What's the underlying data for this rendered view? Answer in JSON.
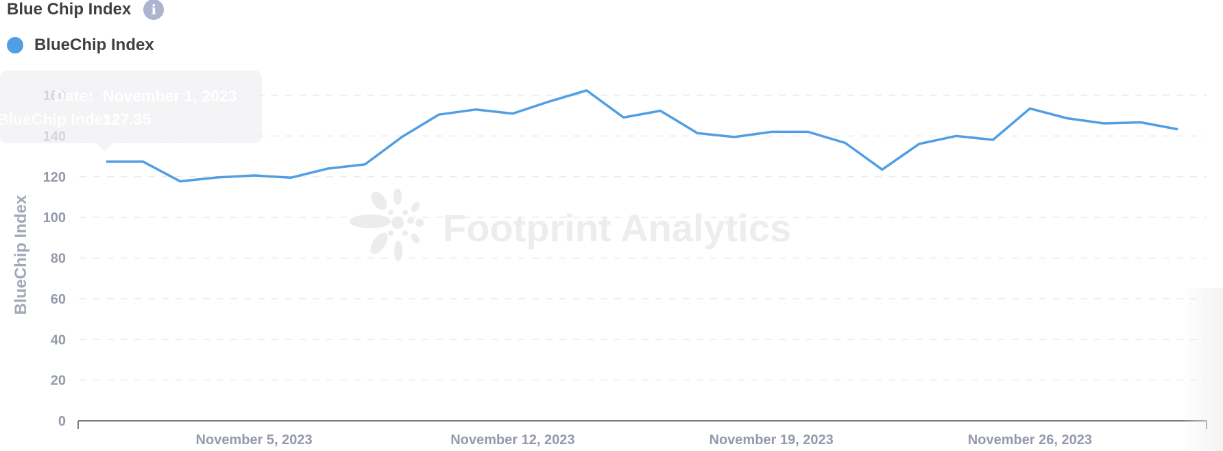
{
  "header": {
    "title": "Blue Chip Index",
    "info_icon": "info-icon"
  },
  "legend": {
    "items": [
      {
        "label": "BlueChip Index",
        "color": "#509ee3"
      }
    ]
  },
  "watermark": "Footprint Analytics",
  "tooltip": {
    "date_key": "Date:",
    "date_value": "November 1, 2023",
    "value_key": "BlueChip Index:",
    "value_value": "127.35"
  },
  "chart_data": {
    "type": "line",
    "title": "Blue Chip Index",
    "xlabel": "",
    "ylabel": "BlueChip Index",
    "ylim": [
      0,
      160
    ],
    "yticks": [
      0,
      20,
      40,
      60,
      80,
      100,
      120,
      140,
      160
    ],
    "grid": true,
    "legend": "top-left",
    "x": [
      "2023-11-01",
      "2023-11-02",
      "2023-11-03",
      "2023-11-04",
      "2023-11-05",
      "2023-11-06",
      "2023-11-07",
      "2023-11-08",
      "2023-11-09",
      "2023-11-10",
      "2023-11-11",
      "2023-11-12",
      "2023-11-13",
      "2023-11-14",
      "2023-11-15",
      "2023-11-16",
      "2023-11-17",
      "2023-11-18",
      "2023-11-19",
      "2023-11-20",
      "2023-11-21",
      "2023-11-22",
      "2023-11-23",
      "2023-11-24",
      "2023-11-25",
      "2023-11-26",
      "2023-11-27",
      "2023-11-28",
      "2023-11-29",
      "2023-11-30"
    ],
    "xtick_labels": [
      {
        "index": 4,
        "label": "November 5, 2023"
      },
      {
        "index": 11,
        "label": "November 12, 2023"
      },
      {
        "index": 18,
        "label": "November 19, 2023"
      },
      {
        "index": 25,
        "label": "November 26, 2023"
      }
    ],
    "series": [
      {
        "name": "BlueChip Index",
        "color": "#509ee3",
        "values": [
          127.35,
          127.35,
          117.7,
          119.6,
          120.6,
          119.5,
          124.0,
          126.0,
          139.5,
          150.5,
          153.0,
          151.0,
          157.0,
          162.4,
          149.1,
          152.4,
          141.4,
          139.5,
          142.0,
          142.0,
          136.6,
          123.5,
          136.1,
          140.0,
          138.1,
          153.5,
          148.7,
          146.2,
          146.7,
          143.3
        ]
      }
    ]
  }
}
